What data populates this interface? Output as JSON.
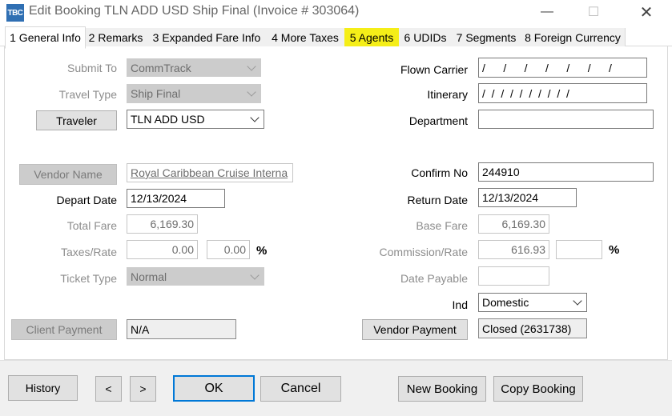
{
  "window": {
    "icon_text": "TBC",
    "title": "Edit Booking TLN ADD USD  Ship Final (Invoice # 303064)",
    "minimize": "—",
    "maximize": "☐",
    "close": "✕"
  },
  "tabs": [
    {
      "label": "1 General Info"
    },
    {
      "label": "2 Remarks"
    },
    {
      "label": "3 Expanded Fare Info"
    },
    {
      "label": "4 More Taxes"
    },
    {
      "label": "5 Agents"
    },
    {
      "label": "6 UDIDs"
    },
    {
      "label": "7 Segments"
    },
    {
      "label": "8 Foreign Currency"
    }
  ],
  "left": {
    "submit_to": {
      "label": "Submit To",
      "value": "CommTrack"
    },
    "travel_type": {
      "label": "Travel Type",
      "value": "Ship Final"
    },
    "traveler": {
      "button": "Traveler",
      "value": "TLN ADD USD"
    },
    "vendor": {
      "button": "Vendor Name",
      "value": "Royal Caribbean Cruise Interna"
    },
    "depart_date": {
      "label": "Depart Date",
      "value": "12/13/2024"
    },
    "total_fare": {
      "label": "Total Fare",
      "value": "6,169.30"
    },
    "taxes": {
      "label": "Taxes/Rate",
      "value": "0.00",
      "rate": "0.00",
      "pct": "%"
    },
    "ticket_type": {
      "label": "Ticket Type",
      "value": "Normal"
    },
    "client_payment": {
      "button": "Client Payment",
      "value": "N/A"
    }
  },
  "right": {
    "flown_carrier": {
      "label": "Flown Carrier",
      "value": "/     /     /     /     /     /     /"
    },
    "itinerary": {
      "label": "Itinerary",
      "value": "/  /  /  /  /  /  /  /  /  /"
    },
    "department": {
      "label": "Department",
      "value": ""
    },
    "confirm_no": {
      "label": "Confirm No",
      "value": "244910"
    },
    "return_date": {
      "label": "Return Date",
      "value": "12/13/2024"
    },
    "base_fare": {
      "label": "Base Fare",
      "value": "6,169.30"
    },
    "commission": {
      "label": "Commission/Rate",
      "value": "616.93",
      "rate": "",
      "pct": "%"
    },
    "date_payable": {
      "label": "Date Payable",
      "value": ""
    },
    "ind": {
      "label": "Ind",
      "value": "Domestic"
    },
    "vendor_payment": {
      "button": "Vendor Payment",
      "value": "Closed (2631738)"
    }
  },
  "footer": {
    "history": "History",
    "prev": "<",
    "next": ">",
    "ok": "OK",
    "cancel": "Cancel",
    "new_booking": "New Booking",
    "copy_booking": "Copy Booking"
  }
}
